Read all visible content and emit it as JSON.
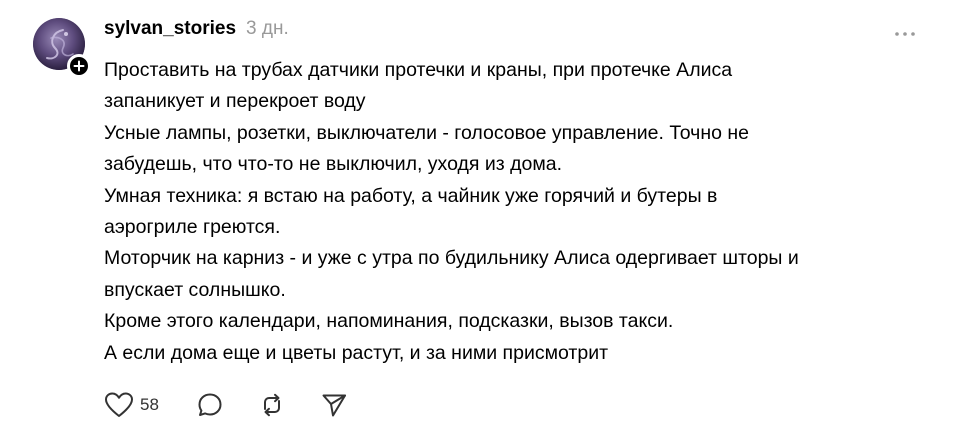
{
  "post": {
    "username": "sylvan_stories",
    "timestamp": "3 дн.",
    "lines": [
      "Проставить на трубах датчики протечки и краны, при протечке Алиса",
      "запаникует и перекроет воду",
      "Усные лампы, розетки, выключатели - голосовое управление. Точно не",
      "забудешь, что что-то не выключил, уходя из дома.",
      "Умная техника: я встаю на работу, а чайник уже горячий и бутеры в",
      "аэрогриле греются.",
      "Моторчик на карниз - и уже с утра по будильнику Алиса одергивает шторы и",
      "впускает солнышко.",
      "Кроме этого календари, напоминания, подсказки, вызов такси.",
      "А если дома еще и цветы растут, и за ними присмотрит"
    ],
    "like_count": "58"
  },
  "icons": {
    "avatar": "avatar-image",
    "follow": "plus-icon",
    "more": "more-horizontal-icon",
    "like": "heart-icon",
    "comment": "comment-icon",
    "repost": "repost-icon",
    "share": "send-icon"
  },
  "colors": {
    "text": "#000000",
    "muted": "#999999",
    "icon": "#333333",
    "background": "#ffffff"
  }
}
